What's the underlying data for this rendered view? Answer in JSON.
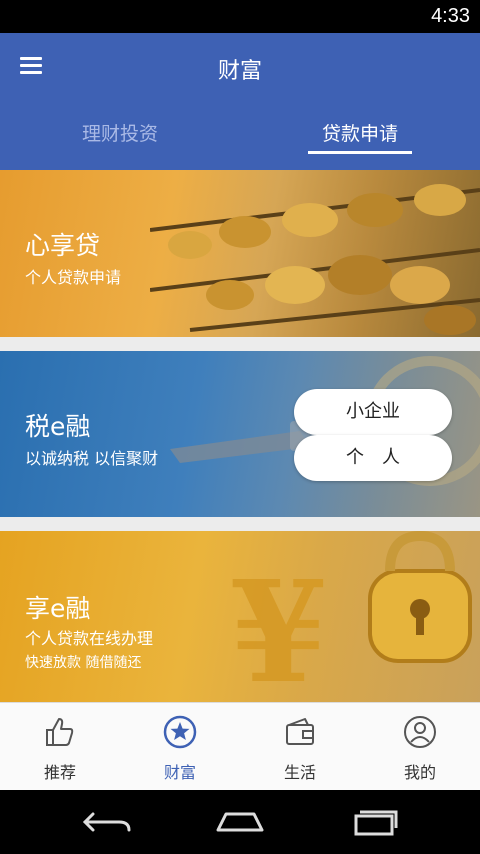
{
  "status_bar": {
    "time": "4:33"
  },
  "header": {
    "title": "财富",
    "tabs": [
      {
        "label": "理财投资",
        "active": false
      },
      {
        "label": "贷款申请",
        "active": true
      }
    ]
  },
  "banners": [
    {
      "title": "心享贷",
      "subtitle": "个人贷款申请"
    },
    {
      "title": "税e融",
      "subtitle": "以诚纳税 以信聚财",
      "buttons": [
        "小企业",
        "个人"
      ]
    },
    {
      "title": "享e融",
      "subtitle": "个人贷款在线办理",
      "subtitle2": "快速放款 随借随还"
    }
  ],
  "bottom_nav": [
    {
      "label": "推荐",
      "icon": "thumbs-up-icon",
      "active": false
    },
    {
      "label": "财富",
      "icon": "star-circle-icon",
      "active": true
    },
    {
      "label": "生活",
      "icon": "wallet-icon",
      "active": false
    },
    {
      "label": "我的",
      "icon": "user-circle-icon",
      "active": false
    }
  ],
  "colors": {
    "primary": "#3e61b4",
    "active_tab": "#ffffff",
    "inactive_tab": "#a9b9e6"
  }
}
